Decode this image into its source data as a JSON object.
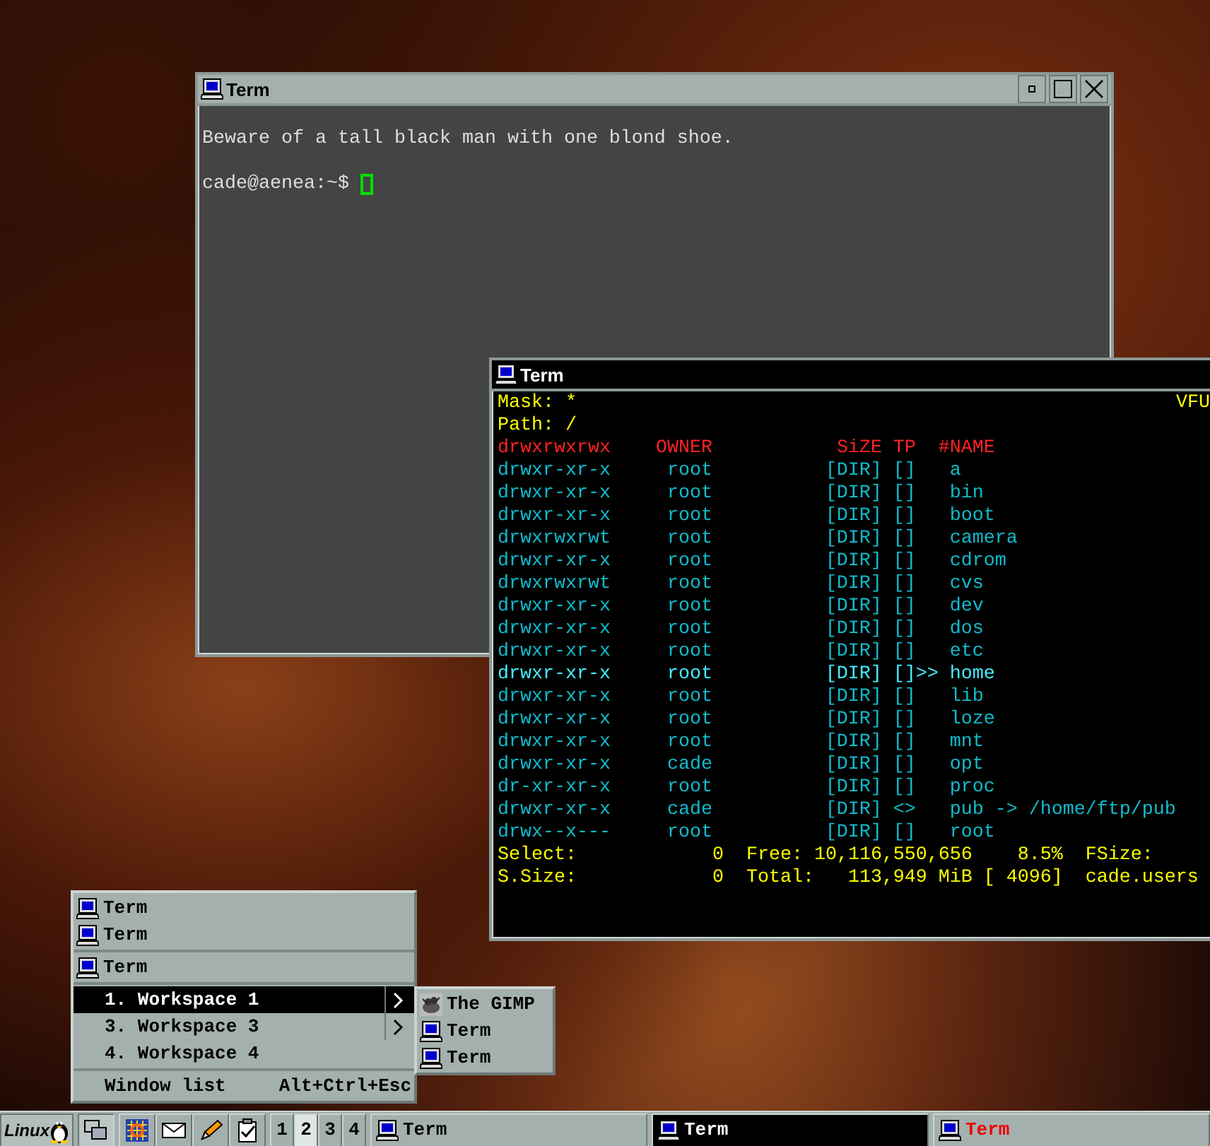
{
  "windows": [
    {
      "kind": "terminal",
      "title": "Term",
      "active": false,
      "lines": [
        "Beware of a tall black man with one blond shoe."
      ],
      "prompt": "cade@aenea:~$ ",
      "controls": [
        {
          "kind": "minimize"
        },
        {
          "kind": "maximize"
        },
        {
          "kind": "close"
        }
      ]
    },
    {
      "kind": "filemanager",
      "title": "Term",
      "active": true,
      "mask_label": "Mask: *",
      "path_label": "Path: /",
      "app_name": "VFU",
      "columns": {
        "permissions": "drwxrwxrwx",
        "owner": "OWNER",
        "size": "SiZE",
        "type": "TP",
        "name": "#NAME"
      },
      "cursor_mark": ">>",
      "rows": [
        {
          "permissions": "drwxr-xr-x",
          "owner": "root",
          "size": "[DIR]",
          "type": "[]",
          "name": "a",
          "selected": false
        },
        {
          "permissions": "drwxr-xr-x",
          "owner": "root",
          "size": "[DIR]",
          "type": "[]",
          "name": "bin",
          "selected": false
        },
        {
          "permissions": "drwxr-xr-x",
          "owner": "root",
          "size": "[DIR]",
          "type": "[]",
          "name": "boot",
          "selected": false
        },
        {
          "permissions": "drwxrwxrwt",
          "owner": "root",
          "size": "[DIR]",
          "type": "[]",
          "name": "camera",
          "selected": false
        },
        {
          "permissions": "drwxr-xr-x",
          "owner": "root",
          "size": "[DIR]",
          "type": "[]",
          "name": "cdrom",
          "selected": false
        },
        {
          "permissions": "drwxrwxrwt",
          "owner": "root",
          "size": "[DIR]",
          "type": "[]",
          "name": "cvs",
          "selected": false
        },
        {
          "permissions": "drwxr-xr-x",
          "owner": "root",
          "size": "[DIR]",
          "type": "[]",
          "name": "dev",
          "selected": false
        },
        {
          "permissions": "drwxr-xr-x",
          "owner": "root",
          "size": "[DIR]",
          "type": "[]",
          "name": "dos",
          "selected": false
        },
        {
          "permissions": "drwxr-xr-x",
          "owner": "root",
          "size": "[DIR]",
          "type": "[]",
          "name": "etc",
          "selected": false
        },
        {
          "permissions": "drwxr-xr-x",
          "owner": "root",
          "size": "[DIR]",
          "type": "[]",
          "name": "home",
          "selected": true
        },
        {
          "permissions": "drwxr-xr-x",
          "owner": "root",
          "size": "[DIR]",
          "type": "[]",
          "name": "lib",
          "selected": false
        },
        {
          "permissions": "drwxr-xr-x",
          "owner": "root",
          "size": "[DIR]",
          "type": "[]",
          "name": "loze",
          "selected": false
        },
        {
          "permissions": "drwxr-xr-x",
          "owner": "root",
          "size": "[DIR]",
          "type": "[]",
          "name": "mnt",
          "selected": false
        },
        {
          "permissions": "drwxr-xr-x",
          "owner": "cade",
          "size": "[DIR]",
          "type": "[]",
          "name": "opt",
          "selected": false
        },
        {
          "permissions": "dr-xr-xr-x",
          "owner": "root",
          "size": "[DIR]",
          "type": "[]",
          "name": "proc",
          "selected": false
        },
        {
          "permissions": "drwxr-xr-x",
          "owner": "cade",
          "size": "[DIR]",
          "type": "<>",
          "name": "pub -> /home/ftp/pub",
          "selected": false
        },
        {
          "permissions": "drwx--x---",
          "owner": "root",
          "size": "[DIR]",
          "type": "[]",
          "name": "root",
          "selected": false
        }
      ],
      "footer": [
        "Select:            0  Free: 10,116,550,656    8.5%  FSize:",
        "S.Size:            0  Total:   113,949 MiB [ 4096]  cade.users"
      ]
    }
  ],
  "window_menu": {
    "groups": [
      [
        {
          "label": "Term",
          "kind": "window",
          "selected": false,
          "submenu": false
        },
        {
          "label": "Term",
          "kind": "window",
          "selected": false,
          "submenu": false
        }
      ],
      [
        {
          "label": "Term",
          "kind": "window",
          "selected": false,
          "submenu": false
        }
      ],
      [
        {
          "label": "1. Workspace 1",
          "kind": "workspace",
          "selected": true,
          "submenu": true
        },
        {
          "label": "3. Workspace 3",
          "kind": "workspace",
          "selected": false,
          "submenu": true
        },
        {
          "label": "4. Workspace 4",
          "kind": "workspace",
          "selected": false,
          "submenu": false
        }
      ],
      [
        {
          "label": "Window list",
          "kind": "command",
          "selected": false,
          "submenu": false,
          "shortcut": "Alt+Ctrl+Esc"
        }
      ]
    ],
    "submenu": [
      {
        "label": "The GIMP",
        "kind": "gimp"
      },
      {
        "label": "Term",
        "kind": "window"
      },
      {
        "label": "Term",
        "kind": "window"
      }
    ]
  },
  "taskbar": {
    "start_label": "Linux",
    "workspaces": [
      {
        "label": "1",
        "selected": false
      },
      {
        "label": "2",
        "selected": true
      },
      {
        "label": "3",
        "selected": false
      },
      {
        "label": "4",
        "selected": false
      }
    ],
    "tasks": [
      {
        "label": "Term",
        "selected": false,
        "urgent": false
      },
      {
        "label": "Term",
        "selected": true,
        "urgent": false
      },
      {
        "label": "Term",
        "selected": false,
        "urgent": true
      }
    ]
  }
}
